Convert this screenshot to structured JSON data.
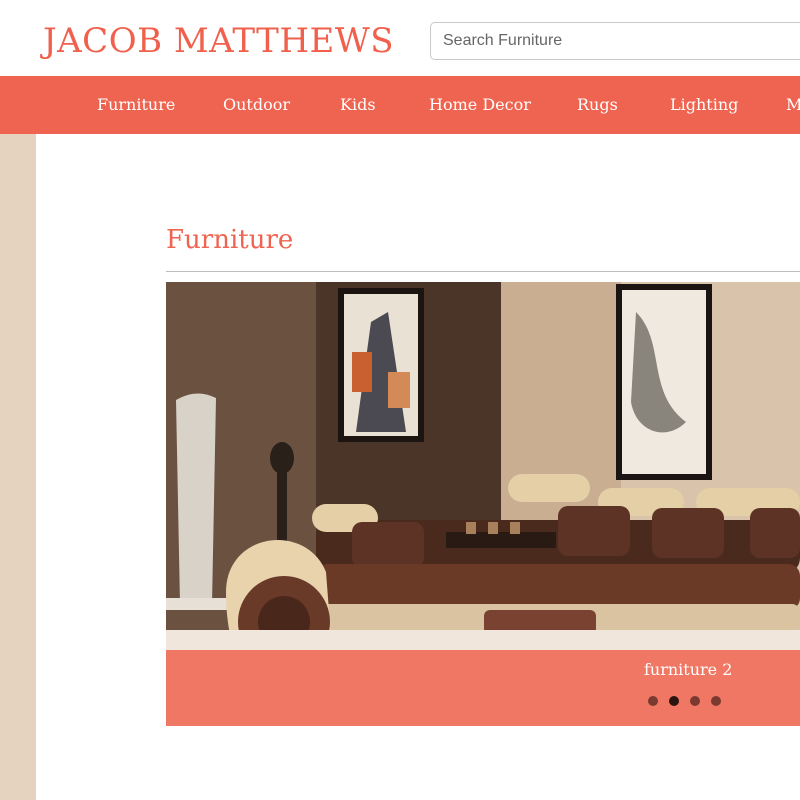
{
  "header": {
    "logo": "JACOB MATTHEWS",
    "search_placeholder": "Search Furniture"
  },
  "nav": {
    "items": [
      {
        "label": "Furniture"
      },
      {
        "label": "Outdoor"
      },
      {
        "label": "Kids"
      },
      {
        "label": "Home Decor"
      },
      {
        "label": "Rugs"
      },
      {
        "label": "Lighting"
      },
      {
        "label": "M"
      }
    ]
  },
  "main": {
    "section_title": "Furniture",
    "slider": {
      "caption": "furniture 2",
      "slide_count": 4,
      "active_slide": 2
    }
  },
  "colors": {
    "brand": "#ef6450",
    "side_strip": "#e6d3bf",
    "nav_text": "#ffffff"
  }
}
